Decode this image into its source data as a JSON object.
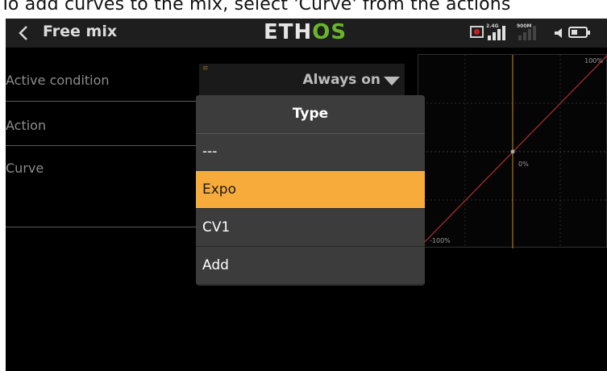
{
  "caption": "To add curves to the mix, select 'Curve' from the actions",
  "header": {
    "title": "Free mix",
    "logo_left": "ETH",
    "logo_right": "OS",
    "signal_24g_label": "2.4G",
    "signal_900m_label": "900M"
  },
  "rows": {
    "active_condition_label": "Active condition",
    "action_label": "Action",
    "curve_label": "Curve"
  },
  "active_condition_value": "Always on",
  "graph": {
    "top_right_label": "100%",
    "center_label": "0%",
    "bottom_left_label": "-100%"
  },
  "dropdown": {
    "title": "Type",
    "options": [
      "---",
      "Expo",
      "CV1",
      "Add"
    ],
    "selected": "Expo"
  },
  "colors": {
    "accent": "#f7ab3a",
    "logo_green": "#6ab52b",
    "curve_line": "#b03030",
    "center_line": "#c8901c"
  },
  "icons": [
    "back-chevron-icon",
    "record-icon",
    "signal-bars-icon",
    "speaker-icon",
    "battery-icon",
    "dropdown-caret-icon"
  ]
}
